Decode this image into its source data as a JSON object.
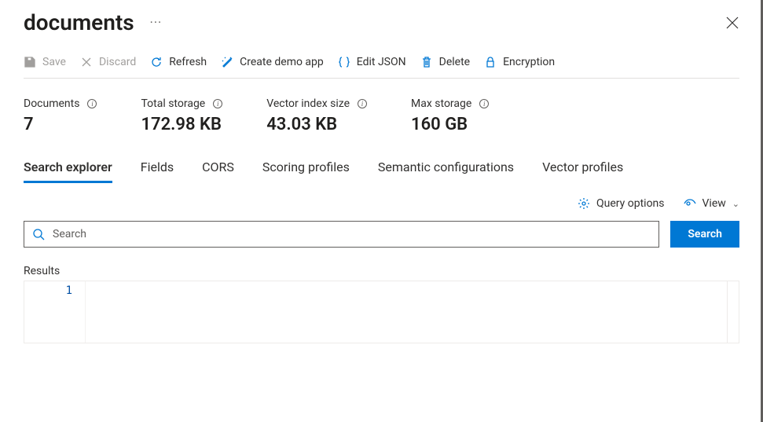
{
  "title": "documents",
  "toolbar": {
    "save": {
      "label": "Save"
    },
    "discard": {
      "label": "Discard"
    },
    "refresh": {
      "label": "Refresh"
    },
    "demo": {
      "label": "Create demo app"
    },
    "json": {
      "label": "Edit JSON"
    },
    "delete": {
      "label": "Delete"
    },
    "enc": {
      "label": "Encryption"
    }
  },
  "stats": {
    "documents": {
      "label": "Documents",
      "value": "7"
    },
    "totalStorage": {
      "label": "Total storage",
      "value": "172.98 KB"
    },
    "vectorIndex": {
      "label": "Vector index size",
      "value": "43.03 KB"
    },
    "maxStorage": {
      "label": "Max storage",
      "value": "160 GB"
    }
  },
  "tabs": {
    "explorer": "Search explorer",
    "fields": "Fields",
    "cors": "CORS",
    "scoring": "Scoring profiles",
    "semantic": "Semantic configurations",
    "vector": "Vector profiles"
  },
  "controls": {
    "queryOptions": "Query options",
    "view": "View"
  },
  "search": {
    "placeholder": "Search",
    "buttonLabel": "Search"
  },
  "results": {
    "label": "Results",
    "lineNumber": "1"
  }
}
